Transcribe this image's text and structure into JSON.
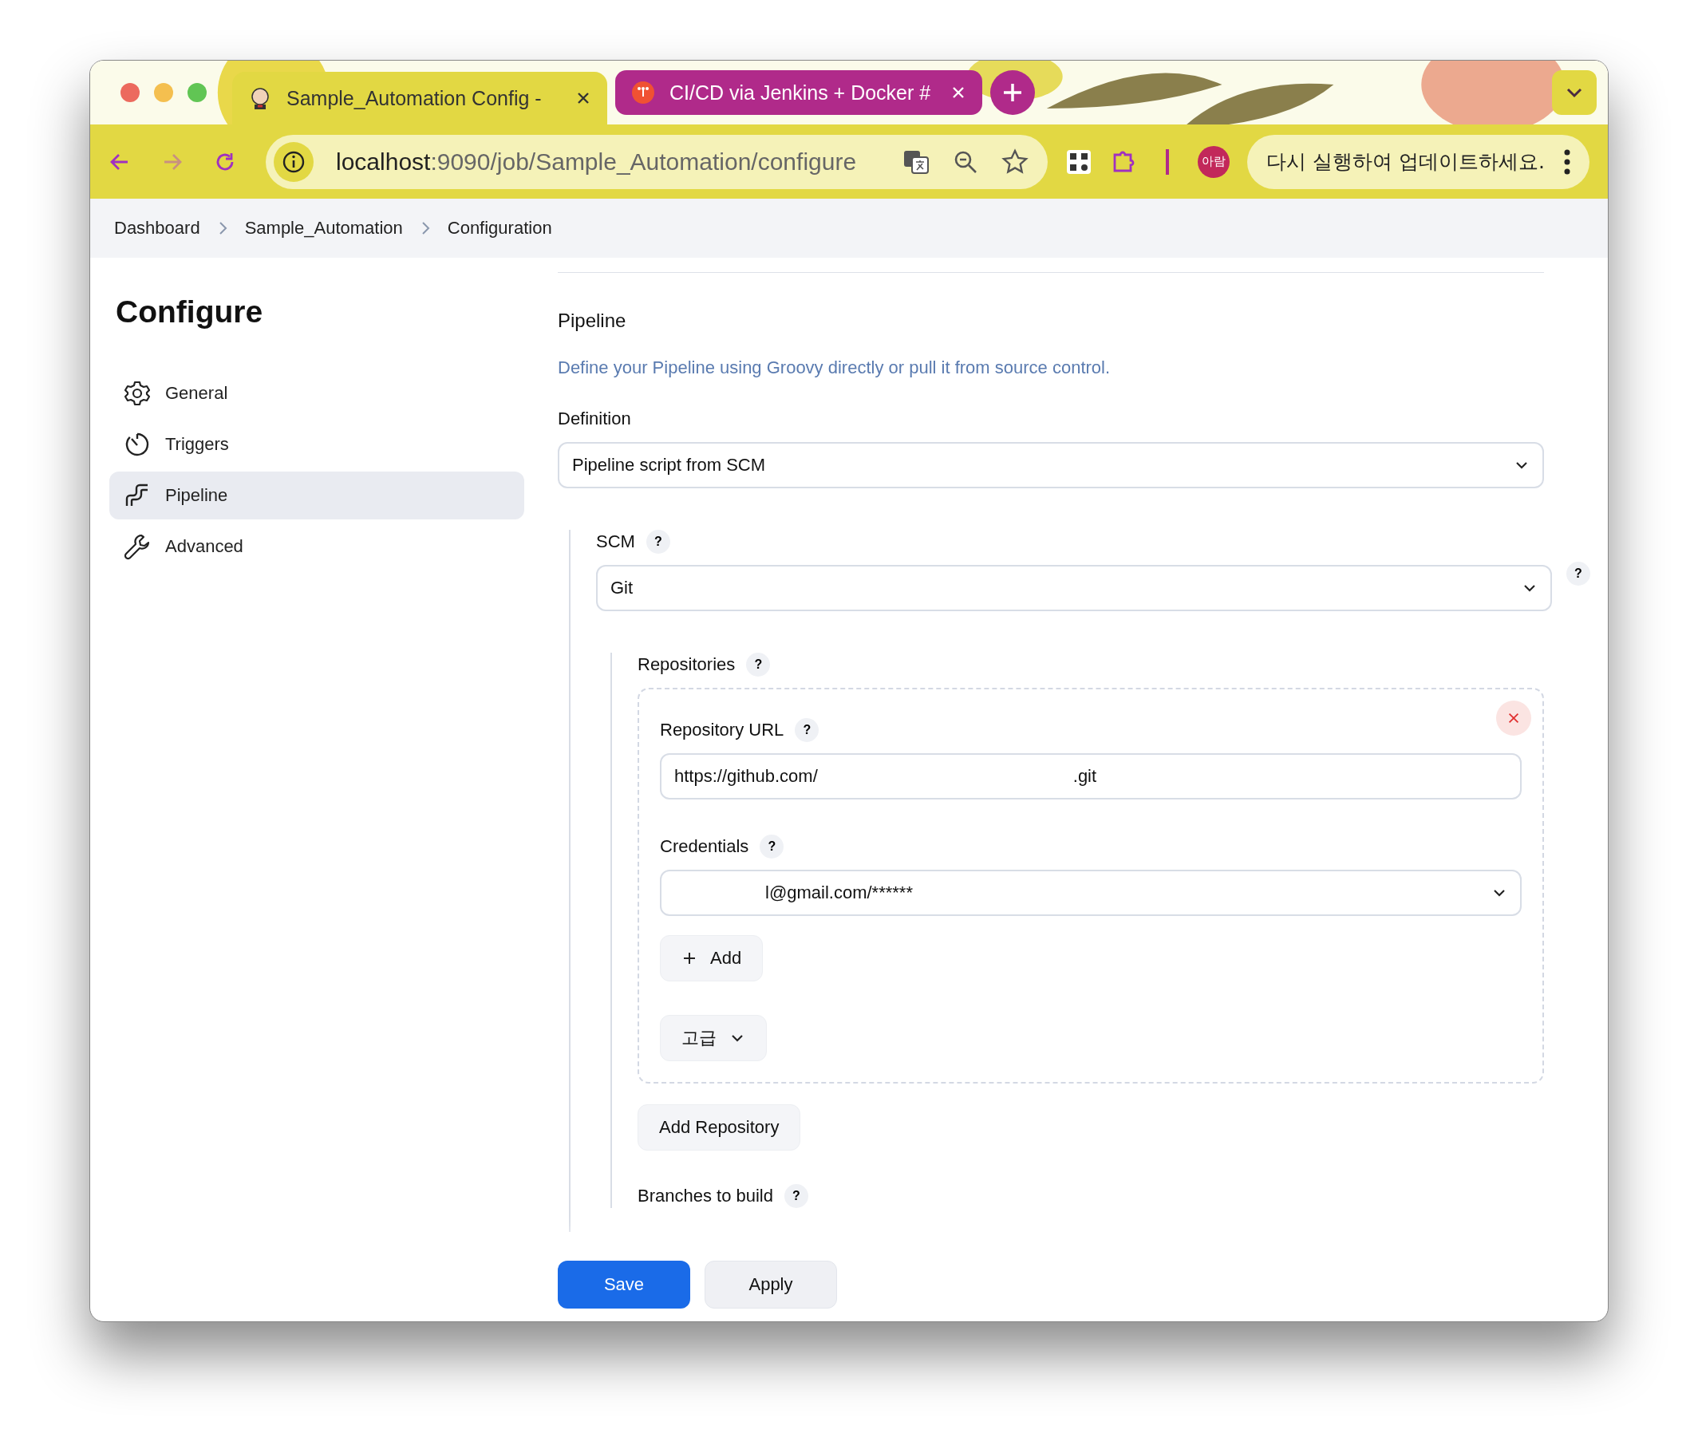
{
  "browser": {
    "tabs": [
      {
        "title": "Sample_Automation Config -",
        "selected": true
      },
      {
        "title": "CI/CD via Jenkins + Docker #",
        "selected": false
      }
    ],
    "address": {
      "host": "localhost",
      "path": ":9090/job/Sample_Automation/configure"
    },
    "profile": "아람",
    "update_button": "다시 실행하여 업데이트하세요."
  },
  "breadcrumbs": [
    "Dashboard",
    "Sample_Automation",
    "Configuration"
  ],
  "sidebar": {
    "title": "Configure",
    "items": [
      {
        "label": "General",
        "selected": false
      },
      {
        "label": "Triggers",
        "selected": false
      },
      {
        "label": "Pipeline",
        "selected": true
      },
      {
        "label": "Advanced",
        "selected": false
      }
    ]
  },
  "pipeline": {
    "title": "Pipeline",
    "description": "Define your Pipeline using Groovy directly or pull it from source control.",
    "definition": {
      "label": "Definition",
      "value": "Pipeline script from SCM"
    },
    "scm": {
      "label": "SCM",
      "help": "?",
      "value": "Git",
      "side_help": "?"
    },
    "repositories": {
      "label": "Repositories",
      "help": "?",
      "url": {
        "label": "Repository URL",
        "help": "?",
        "value_start": "https://github.com/",
        "value_end": ".git"
      },
      "credentials": {
        "label": "Credentials",
        "help": "?",
        "value": "l@gmail.com/******"
      },
      "add_button": "Add",
      "advanced_button": "고급"
    },
    "add_repository": "Add Repository",
    "branches": {
      "label": "Branches to build",
      "help": "?"
    }
  },
  "buttons": {
    "save": "Save",
    "apply": "Apply"
  }
}
